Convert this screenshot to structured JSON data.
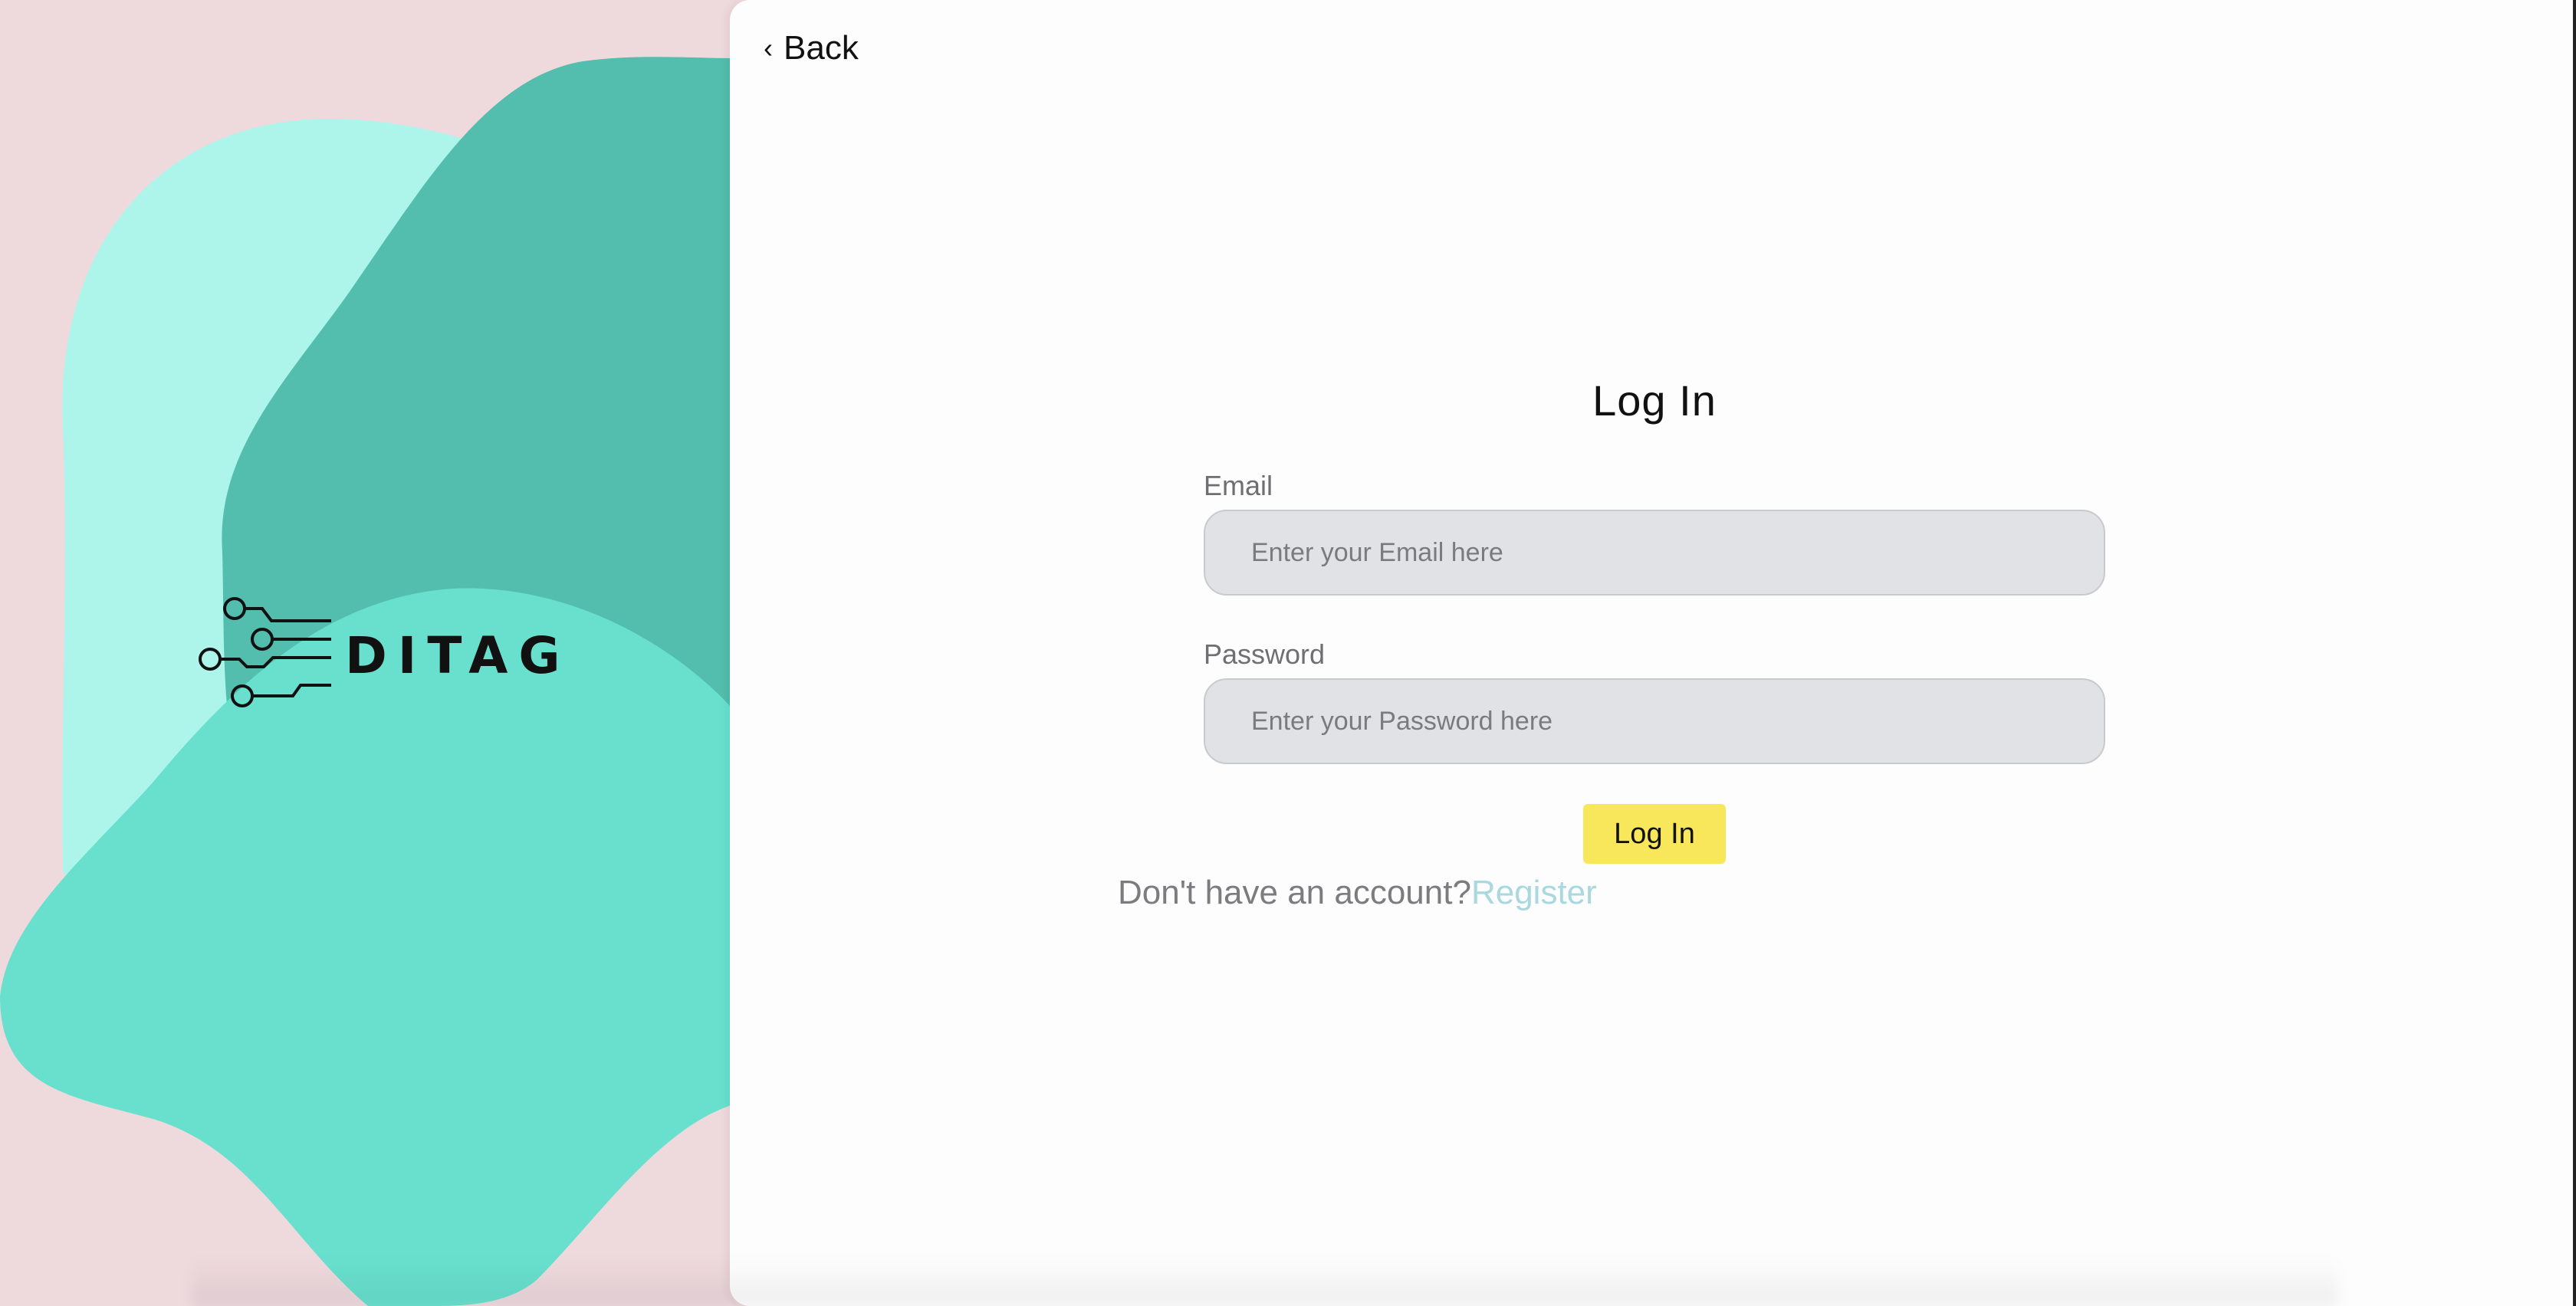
{
  "colors": {
    "left_background": "#eed9dd",
    "blob_light": "#adf5eb",
    "blob_dark": "#53bead",
    "blob_mid": "#69e0ce",
    "button_yellow": "#f9e75b",
    "register_link": "#a9d8df",
    "input_fill": "#e1e2e6"
  },
  "brand": {
    "logo_icon": "circuit-traces-icon",
    "logo_text": "DITAG"
  },
  "nav": {
    "back_icon": "chevron-left-icon",
    "back_label": "Back"
  },
  "form": {
    "title": "Log In",
    "email": {
      "label": "Email",
      "placeholder": "Enter your Email here",
      "value": ""
    },
    "password": {
      "label": "Password",
      "placeholder": "Enter your Password here",
      "value": ""
    },
    "submit_label": "Log In"
  },
  "footer": {
    "prompt": "Don't have an account?",
    "register_label": "Register"
  }
}
